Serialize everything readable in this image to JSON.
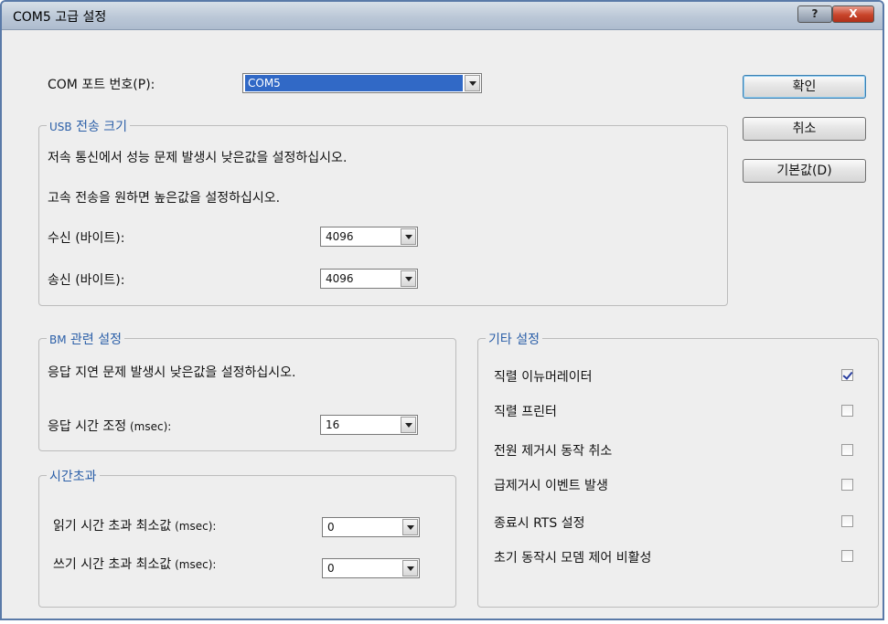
{
  "window": {
    "title": "COM5 고급 설정",
    "help_label": "?",
    "close_label": "X"
  },
  "port": {
    "label": "COM 포트 번호(P):",
    "value": "COM5"
  },
  "buttons": {
    "ok": "확인",
    "cancel": "취소",
    "defaults": "기본값(D)"
  },
  "usb": {
    "legend_prefix": "USB",
    "legend_rest": " 전송 크기",
    "desc1": "저속 통신에서 성능 문제 발생시 낮은값을 설정하십시오.",
    "desc2": "고속 전송을 원하면 높은값을 설정하십시오.",
    "receive_label": "수신 (바이트):",
    "receive_value": "4096",
    "send_label": "송신 (바이트):",
    "send_value": "4096"
  },
  "bm": {
    "legend_prefix": "BM",
    "legend_rest": " 관련 설정",
    "desc": "응답 지연 문제 발생시 낮은값을 설정하십시오.",
    "latency_label": "응답 시간 조정",
    "latency_unit": " (msec):",
    "latency_value": "16"
  },
  "timeouts": {
    "legend": "시간초과",
    "read_label": "읽기 시간 초과 최소값",
    "read_unit": " (msec):",
    "read_value": "0",
    "write_label": "쓰기 시간 초과 최소값",
    "write_unit": " (msec):",
    "write_value": "0"
  },
  "misc": {
    "legend": "기타 설정",
    "options": [
      {
        "label": "직렬 이뉴머레이터",
        "checked": true
      },
      {
        "label": "직렬 프린터",
        "checked": false
      },
      {
        "label": "전원 제거시 동작 취소",
        "checked": false
      },
      {
        "label": "급제거시 이벤트 발생",
        "checked": false
      },
      {
        "label": "종료시 RTS 설정",
        "checked": false
      },
      {
        "label": "초기 동작시 모뎀 제어 비활성",
        "checked": false
      }
    ]
  }
}
